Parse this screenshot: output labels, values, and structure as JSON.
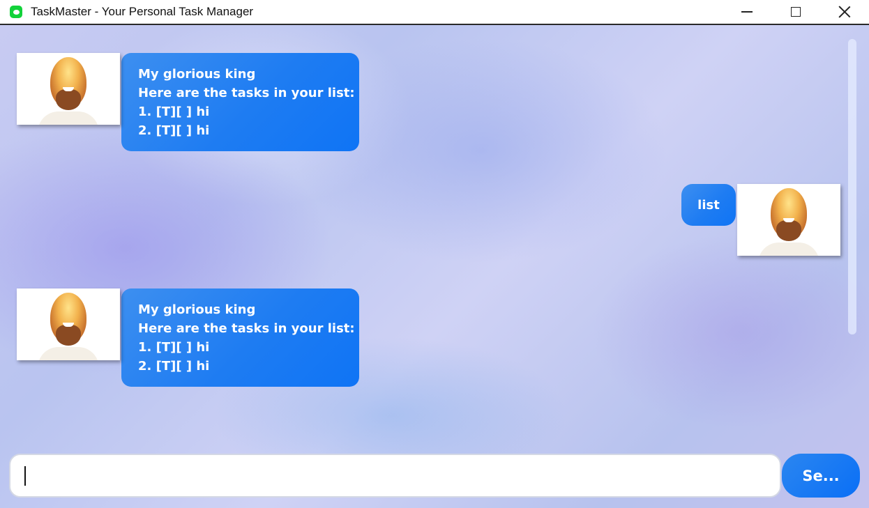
{
  "window": {
    "title": "TaskMaster - Your Personal Task Manager",
    "app_icon": "chat-bubble-icon",
    "controls": [
      "minimize-icon",
      "maximize-icon",
      "close-icon"
    ]
  },
  "messages": [
    {
      "sender": "bot",
      "lines": [
        "My glorious king",
        "Here are the tasks in your list:",
        "1. [T][ ] hi",
        "2. [T][ ] hi"
      ]
    },
    {
      "sender": "user",
      "lines": [
        "list"
      ]
    },
    {
      "sender": "bot",
      "lines": [
        "My glorious king",
        "Here are the tasks in your list:",
        "1. [T][ ] hi",
        "2. [T][ ] hi"
      ]
    }
  ],
  "input": {
    "value": "",
    "placeholder": ""
  },
  "send_button": {
    "label": "Se..."
  },
  "colors": {
    "bubble": "#1e7cf2",
    "send_button": "#0a6ff6",
    "app_icon": "#12d23a"
  }
}
